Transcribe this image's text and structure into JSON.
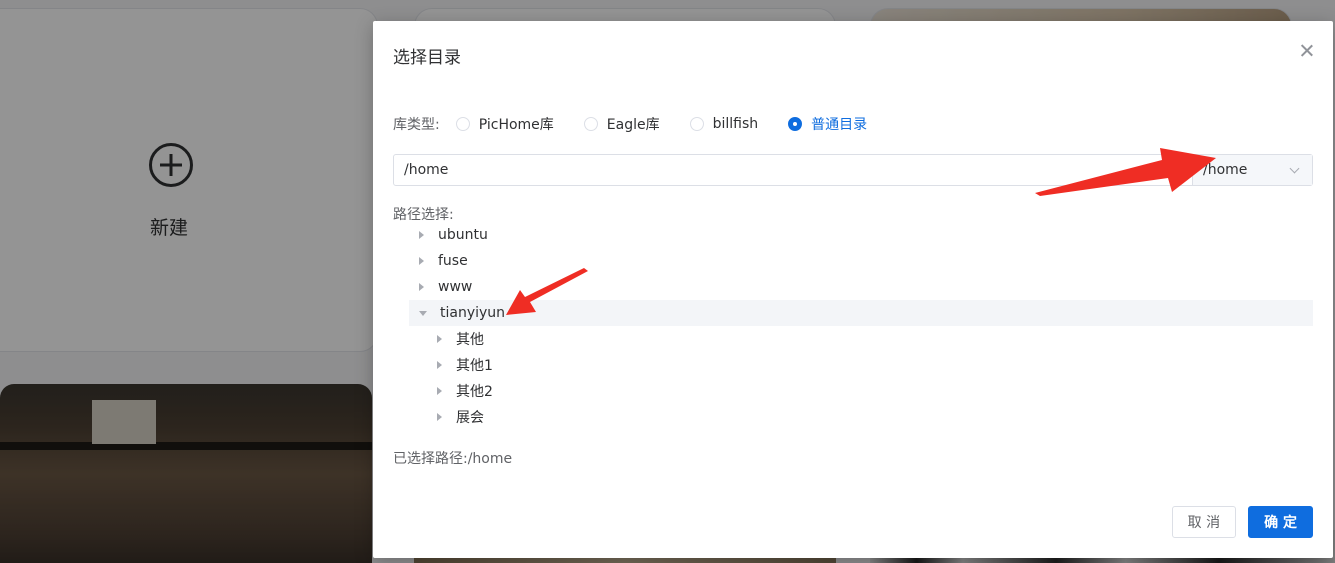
{
  "background": {
    "new_card_label": "新建"
  },
  "dialog": {
    "title": "选择目录",
    "library_type": {
      "label": "库类型:",
      "options": [
        "PicHome库",
        "Eagle库",
        "billfish",
        "普通目录"
      ],
      "selected": "普通目录"
    },
    "path_input_value": "/home",
    "root_select_value": "/home",
    "path_select_label": "路径选择:",
    "tree": [
      {
        "label": "ubuntu",
        "expanded": false,
        "children": []
      },
      {
        "label": "fuse",
        "expanded": false,
        "children": []
      },
      {
        "label": "www",
        "expanded": false,
        "children": []
      },
      {
        "label": "tianyiyun",
        "expanded": true,
        "children": [
          "其他",
          "其他1",
          "其他2",
          "展会"
        ]
      }
    ],
    "selected_path_text": "已选择路径:/home",
    "cancel_label": "取 消",
    "ok_label": "确 定"
  },
  "colors": {
    "primary": "#0f6ddf",
    "annotation_arrow": "#ef2d24",
    "overlay": "rgba(0,0,0,0.42)"
  },
  "icons": [
    "plus-circle-icon",
    "close-icon",
    "chevron-down-icon",
    "caret-right-icon",
    "caret-down-icon"
  ]
}
